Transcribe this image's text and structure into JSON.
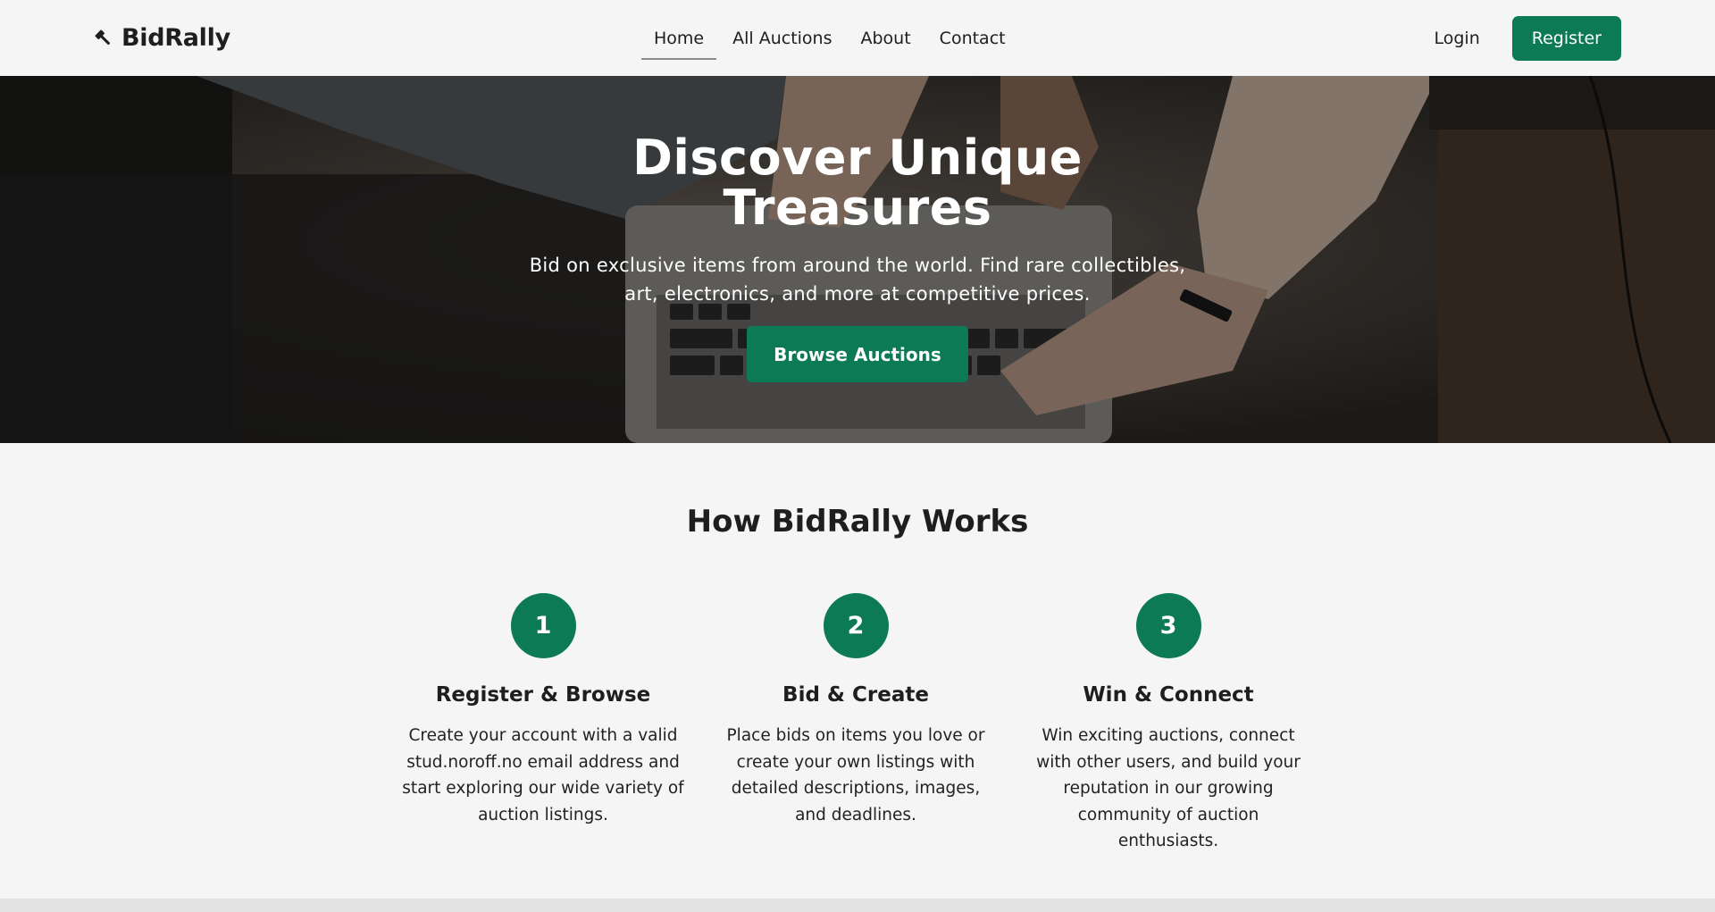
{
  "brand": {
    "name": "BidRally",
    "icon": "gavel-icon"
  },
  "nav": {
    "links": [
      {
        "label": "Home",
        "active": true
      },
      {
        "label": "All Auctions",
        "active": false
      },
      {
        "label": "About",
        "active": false
      },
      {
        "label": "Contact",
        "active": false
      }
    ],
    "login_label": "Login",
    "register_label": "Register"
  },
  "hero": {
    "title": "Discover Unique Treasures",
    "subtitle": "Bid on exclusive items from around the world. Find rare collectibles, art, electronics, and more at competitive prices.",
    "cta_label": "Browse Auctions"
  },
  "how": {
    "title": "How BidRally Works",
    "steps": [
      {
        "number": "1",
        "title": "Register & Browse",
        "text": "Create your account with a valid stud.noroff.no email address and start exploring our wide variety of auction listings."
      },
      {
        "number": "2",
        "title": "Bid & Create",
        "text": "Place bids on items you love or create your own listings with detailed descriptions, images, and deadlines."
      },
      {
        "number": "3",
        "title": "Win & Connect",
        "text": "Win exciting auctions, connect with other users, and build your reputation in our growing community of auction enthusiasts."
      }
    ]
  },
  "colors": {
    "accent": "#0d7a56",
    "background": "#f5f5f5",
    "text": "#1e1e1e"
  }
}
